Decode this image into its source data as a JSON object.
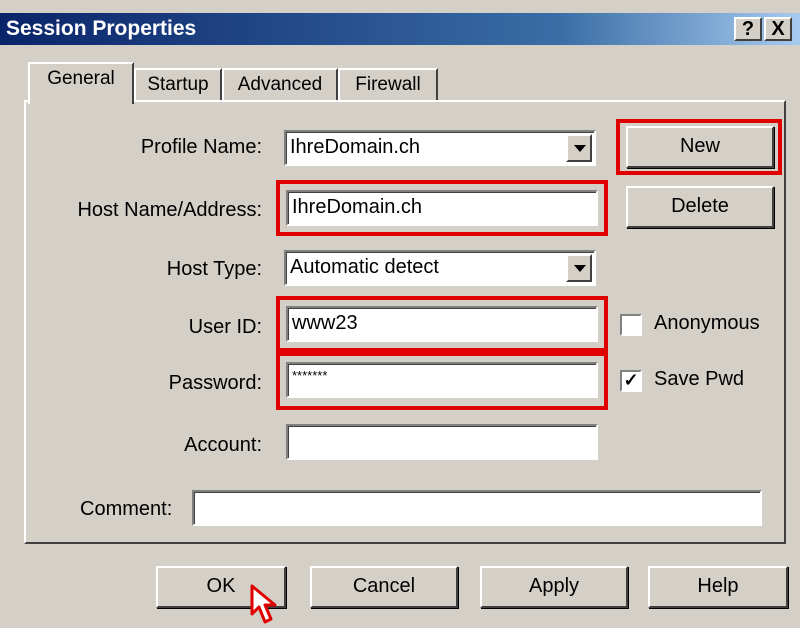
{
  "window": {
    "title": "Session Properties",
    "help_label": "?",
    "close_label": "X"
  },
  "tabs": [
    {
      "label": "General",
      "active": true
    },
    {
      "label": "Startup",
      "active": false
    },
    {
      "label": "Advanced",
      "active": false
    },
    {
      "label": "Firewall",
      "active": false
    }
  ],
  "form": {
    "profile_name": {
      "label": "Profile Name:",
      "value": "IhreDomain.ch"
    },
    "host_name": {
      "label": "Host Name/Address:",
      "value": "IhreDomain.ch"
    },
    "host_type": {
      "label": "Host Type:",
      "value": "Automatic detect"
    },
    "user_id": {
      "label": "User ID:",
      "value": "www23"
    },
    "password": {
      "label": "Password:",
      "value": "*******"
    },
    "account": {
      "label": "Account:",
      "value": ""
    },
    "comment": {
      "label": "Comment:",
      "value": ""
    }
  },
  "side": {
    "new_label": "New",
    "delete_label": "Delete",
    "anonymous_label": "Anonymous",
    "anonymous_checked": false,
    "save_pwd_label": "Save Pwd",
    "save_pwd_checked": true
  },
  "footer": {
    "ok_label": "OK",
    "cancel_label": "Cancel",
    "apply_label": "Apply",
    "help_label": "Help"
  },
  "colors": {
    "highlight": "#e00000",
    "titlebar": "#0a246a",
    "face": "#d4d0c8"
  }
}
